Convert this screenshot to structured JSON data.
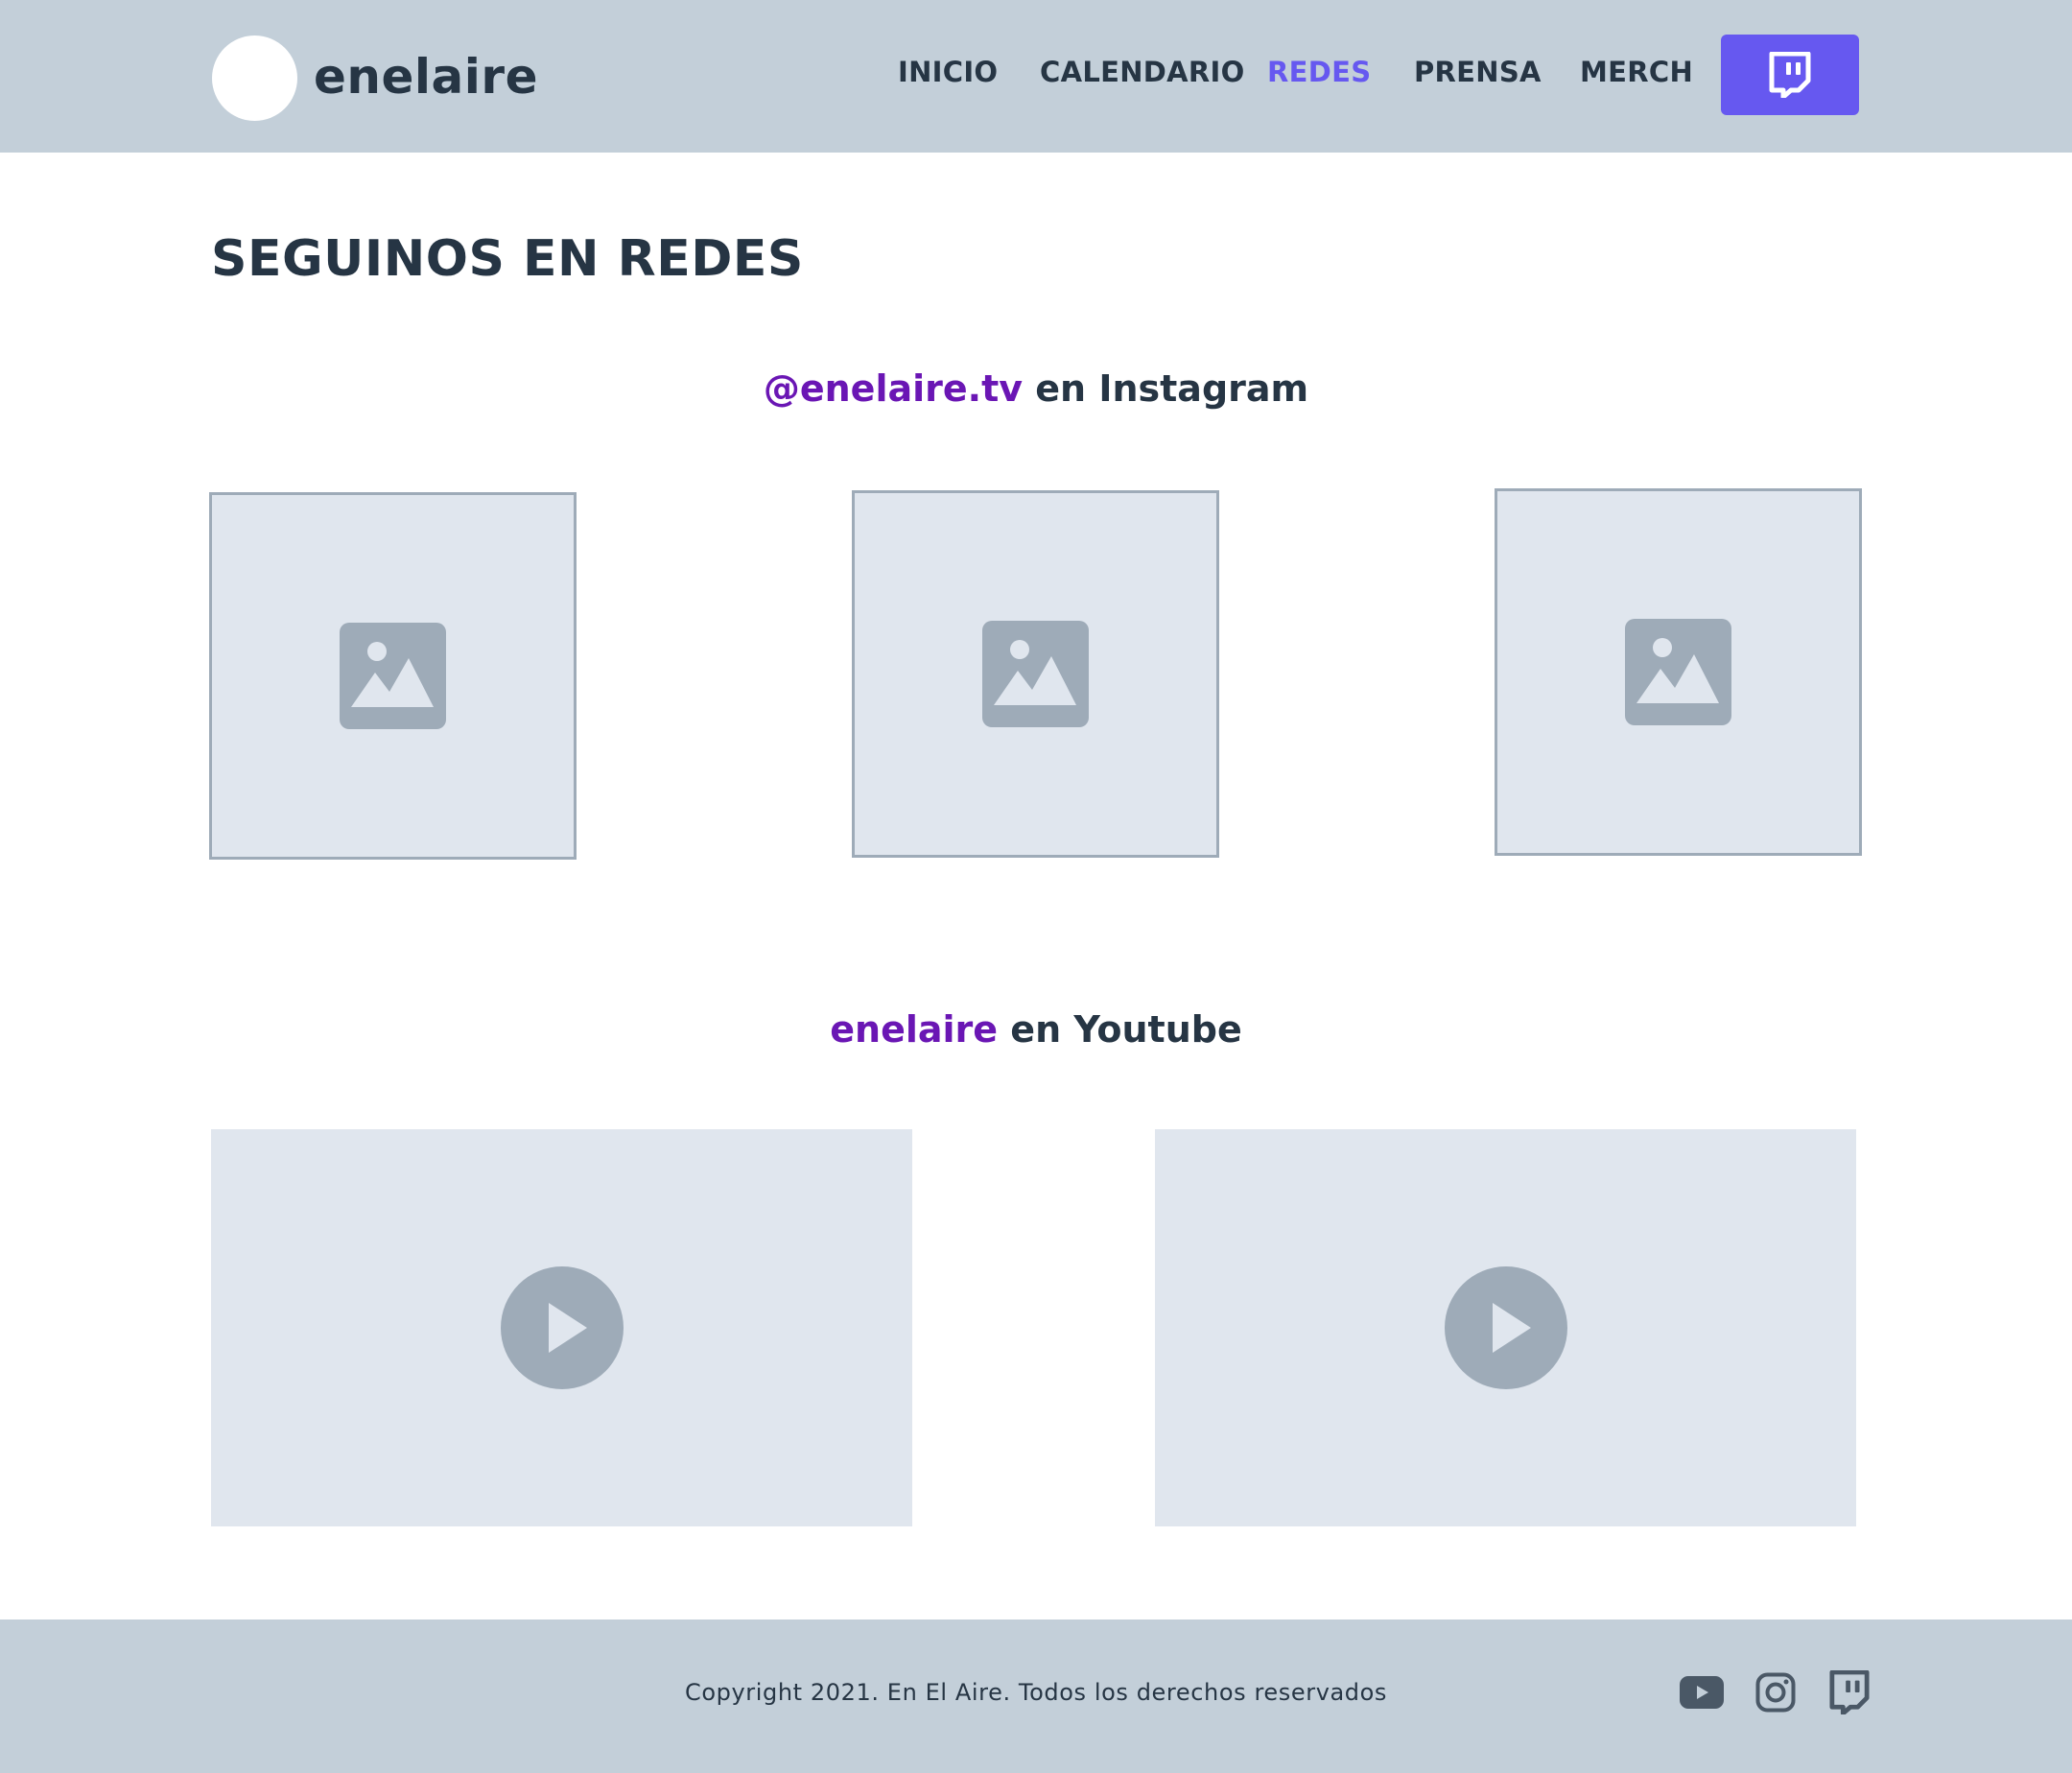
{
  "header": {
    "logo_text": "enelaire",
    "nav": [
      {
        "label": "INICIO",
        "active": false
      },
      {
        "label": "CALENDARIO",
        "active": false
      },
      {
        "label": "REDES",
        "active": true
      },
      {
        "label": "PRENSA",
        "active": false
      },
      {
        "label": "MERCH",
        "active": false
      }
    ],
    "twitch_button_icon": "twitch-icon"
  },
  "main": {
    "title": "SEGUINOS EN REDES",
    "instagram": {
      "handle": "@enelaire.tv",
      "suffix": " en Instagram",
      "posts_icon": "image-placeholder-icon"
    },
    "youtube": {
      "handle": "enelaire",
      "suffix": " en Youtube",
      "videos_icon": "play-icon"
    }
  },
  "footer": {
    "copyright": "Copyright 2021. En El Aire. Todos los derechos reservados",
    "social_icons": [
      "youtube-icon",
      "instagram-icon",
      "twitch-icon"
    ]
  },
  "colors": {
    "header_bg": "#c3cfd9",
    "text": "#263544",
    "accent": "#6658f0",
    "handle": "#6a16b4",
    "placeholder_bg": "#e0e6ee",
    "placeholder_fg": "#9eabb8"
  }
}
